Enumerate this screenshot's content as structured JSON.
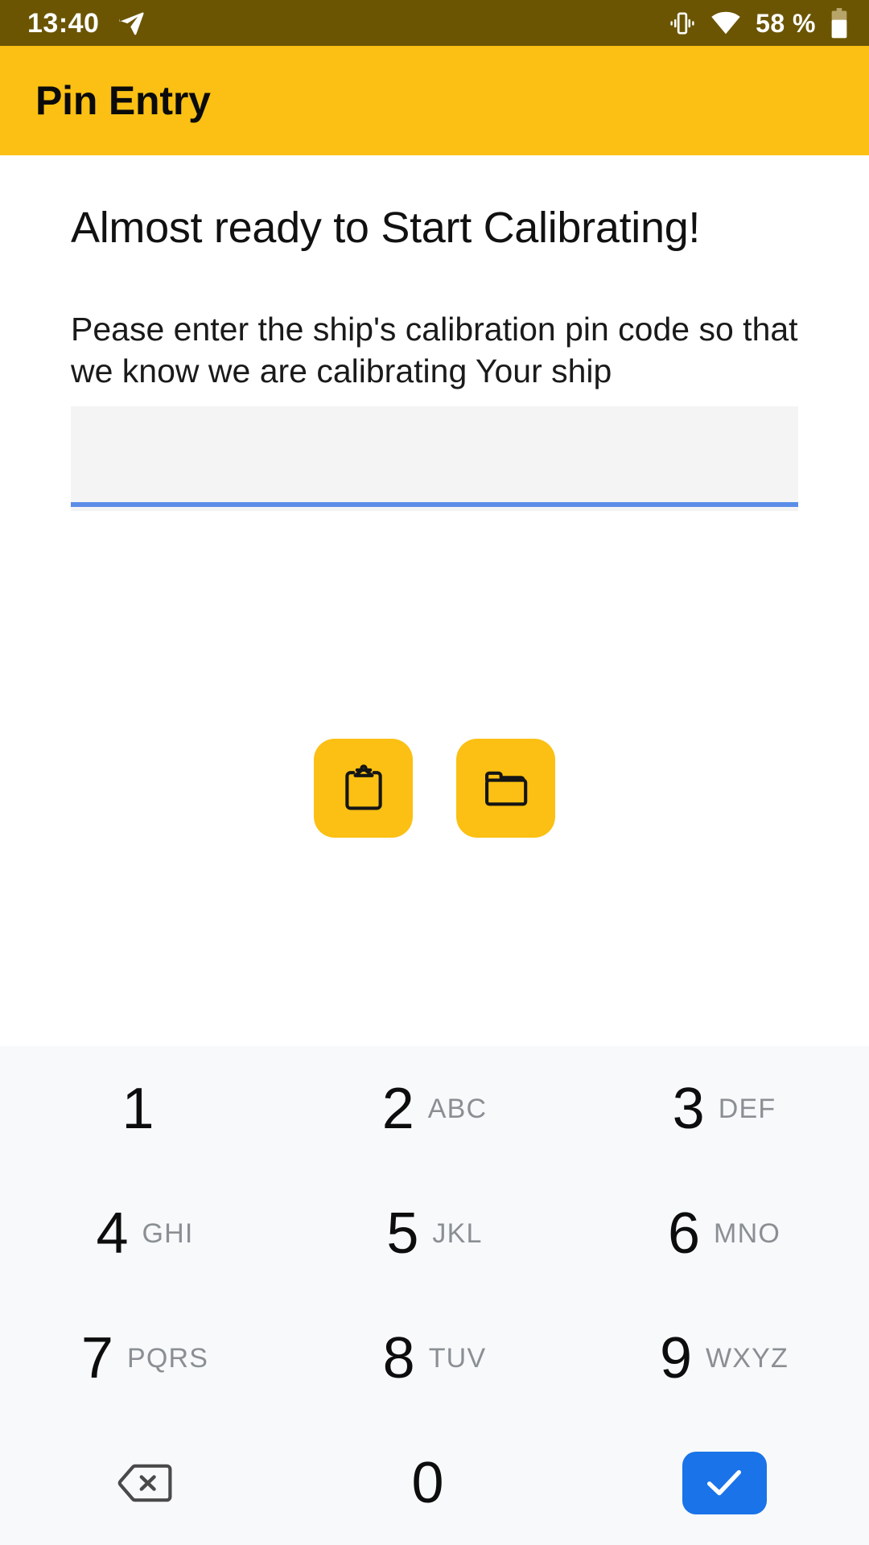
{
  "status_bar": {
    "time": "13:40",
    "battery_text": "58 %",
    "icons": [
      "send-icon",
      "vibrate-icon",
      "wifi-icon",
      "battery-icon"
    ],
    "background_color": "#6B5503",
    "foreground_color": "#FFFFFF"
  },
  "app_bar": {
    "title": "Pin Entry",
    "background_color": "#FBC013",
    "title_color": "#0B0B0B"
  },
  "main": {
    "heading": "Almost ready to Start Calibrating!",
    "description": "Pease enter the ship's calibration pin code so that we know we are calibrating Your ship",
    "pin_input": {
      "value": "",
      "placeholder": "",
      "field_background": "#F4F4F4",
      "underline_color": "#5B8DE8"
    },
    "actions": [
      {
        "name": "paste-from-clipboard-button",
        "icon": "clipboard-icon",
        "label": "",
        "color": "#FBC013"
      },
      {
        "name": "open-file-browser-button",
        "icon": "folder-icon",
        "label": "",
        "color": "#FBC013"
      }
    ]
  },
  "keypad": {
    "background_color": "#F7F9FB",
    "digit_color": "#0D0D0D",
    "letters_color": "#8B8F93",
    "confirm_color": "#1A73E8",
    "rows": [
      [
        {
          "digit": "1",
          "letters": "",
          "type": "digit"
        },
        {
          "digit": "2",
          "letters": "ABC",
          "type": "digit"
        },
        {
          "digit": "3",
          "letters": "DEF",
          "type": "digit"
        }
      ],
      [
        {
          "digit": "4",
          "letters": "GHI",
          "type": "digit"
        },
        {
          "digit": "5",
          "letters": "JKL",
          "type": "digit"
        },
        {
          "digit": "6",
          "letters": "MNO",
          "type": "digit"
        }
      ],
      [
        {
          "digit": "7",
          "letters": "PQRS",
          "type": "digit"
        },
        {
          "digit": "8",
          "letters": "TUV",
          "type": "digit"
        },
        {
          "digit": "9",
          "letters": "WXYZ",
          "type": "digit"
        }
      ],
      [
        {
          "digit": "",
          "letters": "",
          "type": "backspace"
        },
        {
          "digit": "0",
          "letters": "",
          "type": "digit"
        },
        {
          "digit": "",
          "letters": "",
          "type": "confirm"
        }
      ]
    ]
  }
}
